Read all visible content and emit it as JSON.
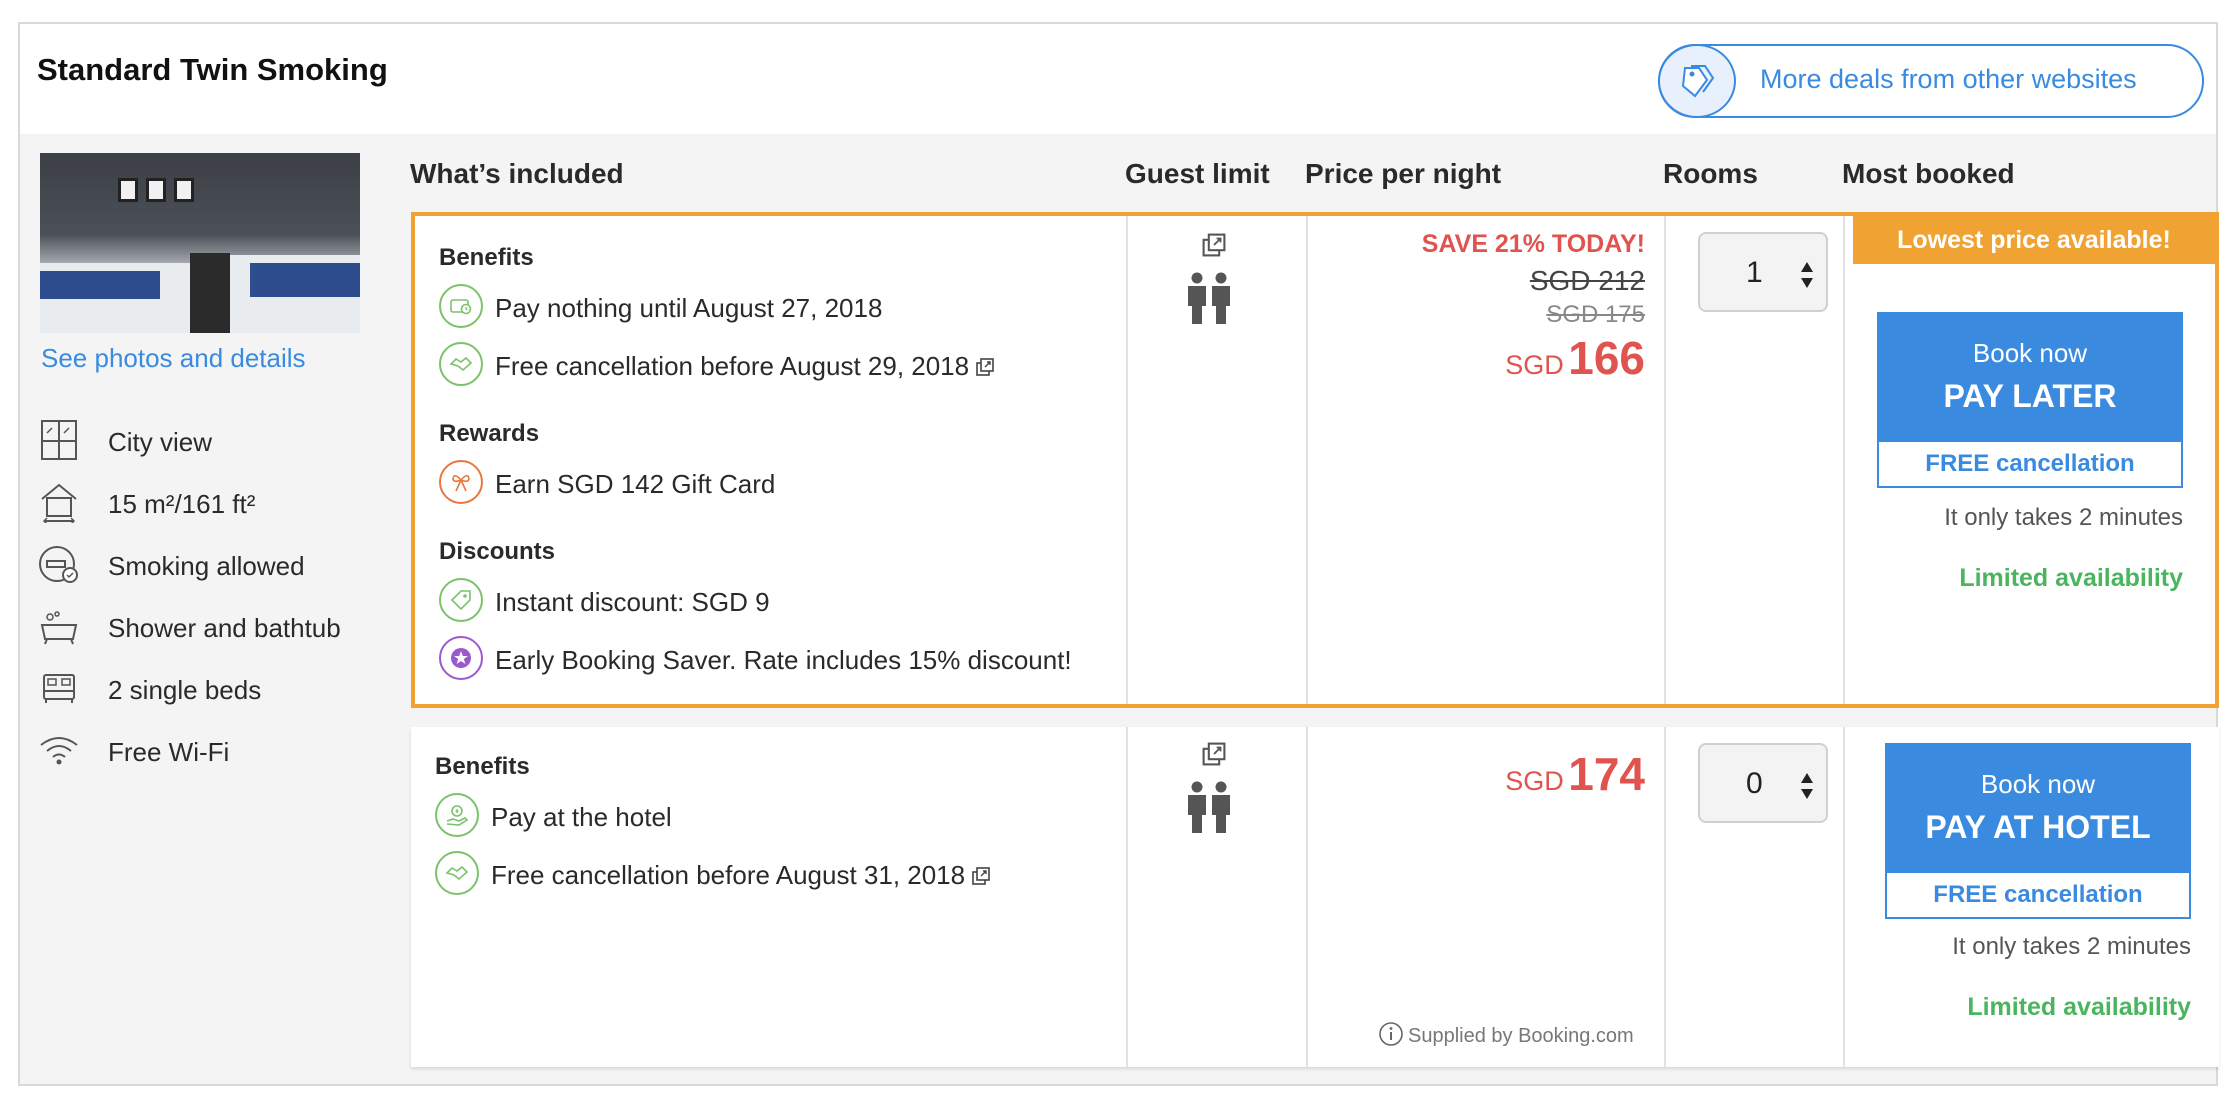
{
  "room": {
    "title": "Standard Twin Smoking",
    "deals_button": "More deals from other websites",
    "see_photos": "See photos and details",
    "amenities": [
      {
        "icon": "window-icon",
        "label": "City view"
      },
      {
        "icon": "house-icon",
        "label": "15 m²/161 ft²"
      },
      {
        "icon": "smoking-icon",
        "label": "Smoking allowed"
      },
      {
        "icon": "bathtub-icon",
        "label": "Shower and bathtub"
      },
      {
        "icon": "bed-icon",
        "label": "2 single beds"
      },
      {
        "icon": "wifi-icon",
        "label": "Free Wi-Fi"
      }
    ]
  },
  "columns": {
    "included": "What’s included",
    "guest_limit": "Guest limit",
    "price_per_night": "Price per night",
    "rooms": "Rooms",
    "most_booked": "Most booked"
  },
  "offers": [
    {
      "sections": {
        "benefits_label": "Benefits",
        "rewards_label": "Rewards",
        "discounts_label": "Discounts"
      },
      "benefits": [
        {
          "icon": "wallet-clock-icon",
          "text": "Pay nothing until August 27, 2018"
        },
        {
          "icon": "handshake-icon",
          "text": "Free cancellation before August 29, 2018"
        }
      ],
      "rewards": [
        {
          "icon": "gift-icon",
          "text": "Earn SGD 142 Gift Card"
        }
      ],
      "discounts": [
        {
          "icon": "tag-icon",
          "text": "Instant discount: SGD 9"
        },
        {
          "icon": "star-badge-icon",
          "text": "Early Booking Saver. Rate includes 15% discount!"
        }
      ],
      "guests": 2,
      "price": {
        "save": "SAVE 21% TODAY!",
        "original": "SGD 212",
        "was": "SGD 175",
        "currency": "SGD",
        "amount": "166"
      },
      "rooms_selected": "1",
      "banner": "Lowest price available!",
      "book": {
        "line1": "Book now",
        "line2": "PAY LATER",
        "free": "FREE cancellation"
      },
      "takes": "It only takes 2 minutes",
      "availability": "Limited availability"
    },
    {
      "sections": {
        "benefits_label": "Benefits"
      },
      "benefits": [
        {
          "icon": "money-hand-icon",
          "text": "Pay at the hotel"
        },
        {
          "icon": "handshake-icon",
          "text": "Free cancellation before August 31, 2018"
        }
      ],
      "guests": 2,
      "price": {
        "currency": "SGD",
        "amount": "174"
      },
      "rooms_selected": "0",
      "supplied": "Supplied by Booking.com",
      "book": {
        "line1": "Book now",
        "line2": "PAY AT HOTEL",
        "free": "FREE cancellation"
      },
      "takes": "It only takes 2 minutes",
      "availability": "Limited availability"
    }
  ],
  "colors": {
    "accent_blue": "#3a8be0",
    "highlight_orange": "#f0a232",
    "price_red": "#e0534e",
    "availability_green": "#4bb45e",
    "feature_green": "#7bc26a"
  }
}
